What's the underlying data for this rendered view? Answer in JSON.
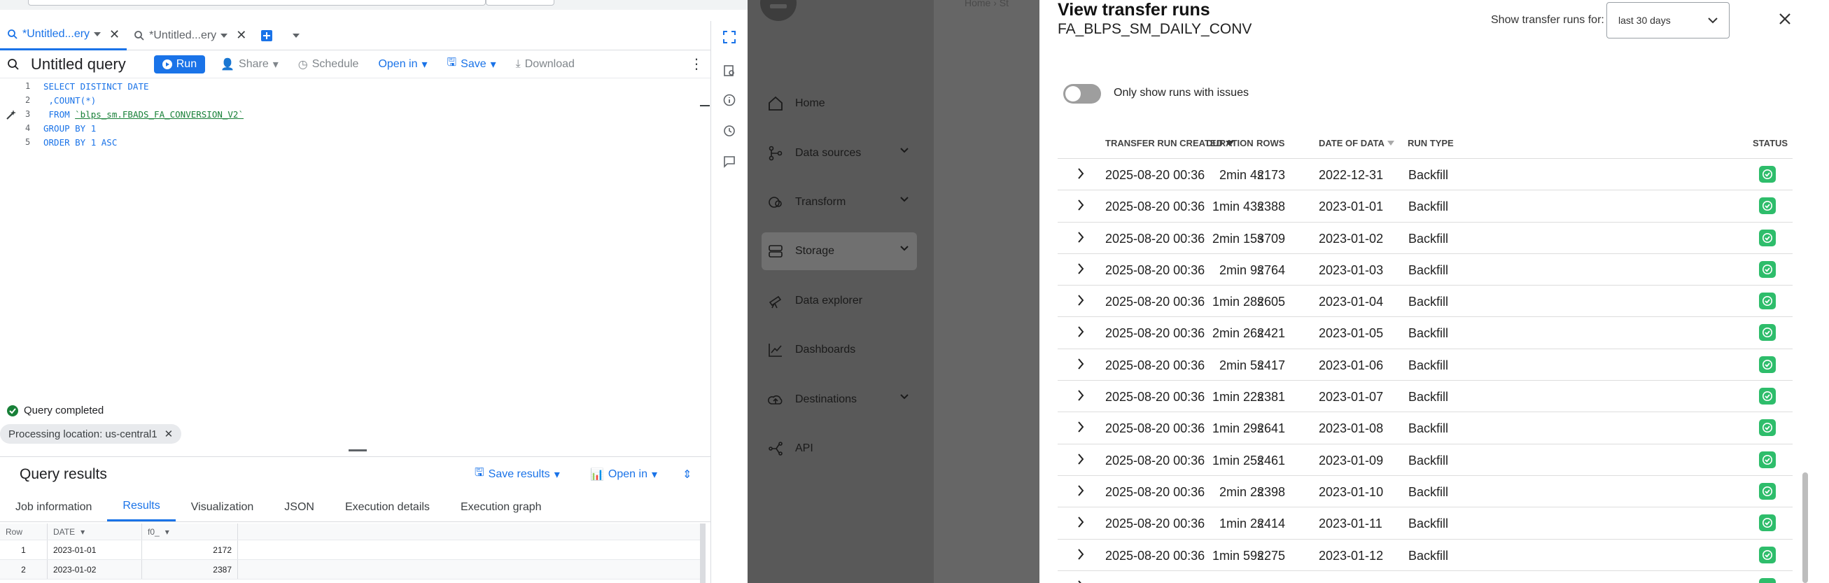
{
  "bigquery": {
    "tabs": [
      {
        "label": "*Untitled...ery",
        "active": true
      },
      {
        "label": "*Untitled...ery",
        "active": false
      }
    ],
    "toolbar": {
      "title": "Untitled query",
      "run": "Run",
      "share": "Share",
      "schedule": "Schedule",
      "open_in": "Open in",
      "save": "Save",
      "download": "Download"
    },
    "editor": {
      "line_numbers": [
        "1",
        "2",
        "3",
        "4",
        "5"
      ],
      "lines": [
        "SELECT DISTINCT DATE",
        " ,COUNT(*)",
        " FROM ",
        "GROUP BY 1",
        "ORDER BY 1 ASC"
      ],
      "table_ref": "`blps_sm.FBADS_FA_CONVERSION_V2`"
    },
    "status": "Query completed",
    "processing_chip": "Processing location: us-central1",
    "results": {
      "title": "Query results",
      "save_results": "Save results",
      "open_in": "Open in",
      "tabs": [
        "Job information",
        "Results",
        "Visualization",
        "JSON",
        "Execution details",
        "Execution graph"
      ],
      "active_tab": "Results",
      "columns": [
        "Row",
        "DATE",
        "f0_"
      ],
      "rows": [
        [
          "1",
          "2023-01-01",
          "2172"
        ],
        [
          "2",
          "2023-01-02",
          "2387"
        ]
      ]
    }
  },
  "sidebar": {
    "breadcrumb": "Home   ›   St",
    "items": [
      {
        "label": "Home",
        "icon": "home-icon",
        "expandable": false
      },
      {
        "label": "Data sources",
        "icon": "data-sources-icon",
        "expandable": true
      },
      {
        "label": "Transform",
        "icon": "transform-icon",
        "expandable": true
      },
      {
        "label": "Storage",
        "icon": "storage-icon",
        "expandable": true,
        "active": true
      },
      {
        "label": "Data explorer",
        "icon": "telescope-icon",
        "expandable": false
      },
      {
        "label": "Dashboards",
        "icon": "chart-icon",
        "expandable": false
      },
      {
        "label": "Destinations",
        "icon": "upload-icon",
        "expandable": true
      },
      {
        "label": "API",
        "icon": "api-icon",
        "expandable": false
      }
    ]
  },
  "modal": {
    "title": "View transfer runs",
    "subtitle": "FA_BLPS_SM_DAILY_CONV",
    "range_label": "Show transfer runs for:",
    "range_value": "last 30 days",
    "toggle_label": "Only show runs with issues",
    "columns": {
      "created": "TRANSFER RUN CREATED",
      "duration": "DURATION",
      "rows": "ROWS",
      "date": "DATE OF DATA",
      "run_type": "RUN TYPE",
      "status": "STATUS"
    },
    "runs": [
      {
        "created": "2025-08-20 00:36",
        "duration": "2min 4s",
        "rows": "2173",
        "date": "2022-12-31",
        "run_type": "Backfill"
      },
      {
        "created": "2025-08-20 00:36",
        "duration": "1min 43s",
        "rows": "2388",
        "date": "2023-01-01",
        "run_type": "Backfill"
      },
      {
        "created": "2025-08-20 00:36",
        "duration": "2min 15s",
        "rows": "3709",
        "date": "2023-01-02",
        "run_type": "Backfill"
      },
      {
        "created": "2025-08-20 00:36",
        "duration": "2min 9s",
        "rows": "2764",
        "date": "2023-01-03",
        "run_type": "Backfill"
      },
      {
        "created": "2025-08-20 00:36",
        "duration": "1min 28s",
        "rows": "2605",
        "date": "2023-01-04",
        "run_type": "Backfill"
      },
      {
        "created": "2025-08-20 00:36",
        "duration": "2min 26s",
        "rows": "2421",
        "date": "2023-01-05",
        "run_type": "Backfill"
      },
      {
        "created": "2025-08-20 00:36",
        "duration": "2min 5s",
        "rows": "2417",
        "date": "2023-01-06",
        "run_type": "Backfill"
      },
      {
        "created": "2025-08-20 00:36",
        "duration": "1min 22s",
        "rows": "2381",
        "date": "2023-01-07",
        "run_type": "Backfill"
      },
      {
        "created": "2025-08-20 00:36",
        "duration": "1min 29s",
        "rows": "2641",
        "date": "2023-01-08",
        "run_type": "Backfill"
      },
      {
        "created": "2025-08-20 00:36",
        "duration": "1min 25s",
        "rows": "2461",
        "date": "2023-01-09",
        "run_type": "Backfill"
      },
      {
        "created": "2025-08-20 00:36",
        "duration": "2min 2s",
        "rows": "2398",
        "date": "2023-01-10",
        "run_type": "Backfill"
      },
      {
        "created": "2025-08-20 00:36",
        "duration": "1min 2s",
        "rows": "2414",
        "date": "2023-01-11",
        "run_type": "Backfill"
      },
      {
        "created": "2025-08-20 00:36",
        "duration": "1min 59s",
        "rows": "2275",
        "date": "2023-01-12",
        "run_type": "Backfill"
      }
    ]
  },
  "colors": {
    "accent": "#1a73e8",
    "success": "#2ebd6b",
    "overlay": "#666666"
  }
}
